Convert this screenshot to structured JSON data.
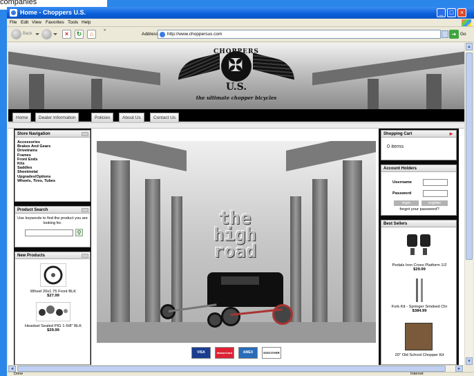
{
  "caption": "companies",
  "window": {
    "title": "Home - Choppers U.S."
  },
  "menu": [
    "File",
    "Edit",
    "View",
    "Favorites",
    "Tools",
    "Help"
  ],
  "toolbar": {
    "back_label": "Back",
    "chevron_label": "»",
    "address_label": "Address",
    "url": "http://www.choppersus.com",
    "go_label": "Go"
  },
  "brand": {
    "name": "CHOPPERS",
    "country": "U.S.",
    "tagline": "the ultimate chopper bicycles"
  },
  "nav": [
    "Home",
    "Dealer Information",
    "Policies",
    "About Us",
    "Contact Us"
  ],
  "store_nav": {
    "title": "Store Navigation",
    "categories": [
      "Accessories",
      "Brakes And Gears",
      "Drivetrains",
      "Frames",
      "Front Ends",
      "Kits",
      "Saddles",
      "Sheetmetal",
      "Upgrades/Options",
      "Wheels, Tires, Tubes"
    ]
  },
  "product_search": {
    "title": "Product Search",
    "text": "Use keywords to find the product you are looking for."
  },
  "new_products": {
    "title": "New Products",
    "items": [
      {
        "name": "Wheel 20x1.75 Front BLK",
        "price": "$27.99"
      },
      {
        "name": "Headset Sealed PIG 1-5/8\" BLK",
        "price": "$29.99"
      }
    ]
  },
  "banner": {
    "headline": "the high road"
  },
  "cards": [
    "VISA",
    "MasterCard",
    "AMEX",
    "DISCOVER"
  ],
  "cart": {
    "title": "Shopping Cart",
    "items": "0 items"
  },
  "account": {
    "title": "Account Holders",
    "username_label": "Username",
    "password_label": "Password",
    "login_label": "login",
    "register_label": "register",
    "forgot": "forgot your password?"
  },
  "best_sellers": {
    "title": "Best Sellers",
    "items": [
      {
        "name": "Pedals Iron Cross Platform 1/2",
        "price": "$29.99"
      },
      {
        "name": "Fork Kit - Springer Smoked Chr",
        "price": "$384.99"
      },
      {
        "name": "20\" Old School Chopper Kit"
      }
    ]
  },
  "status": {
    "left": "Done",
    "zone": "Internet"
  }
}
